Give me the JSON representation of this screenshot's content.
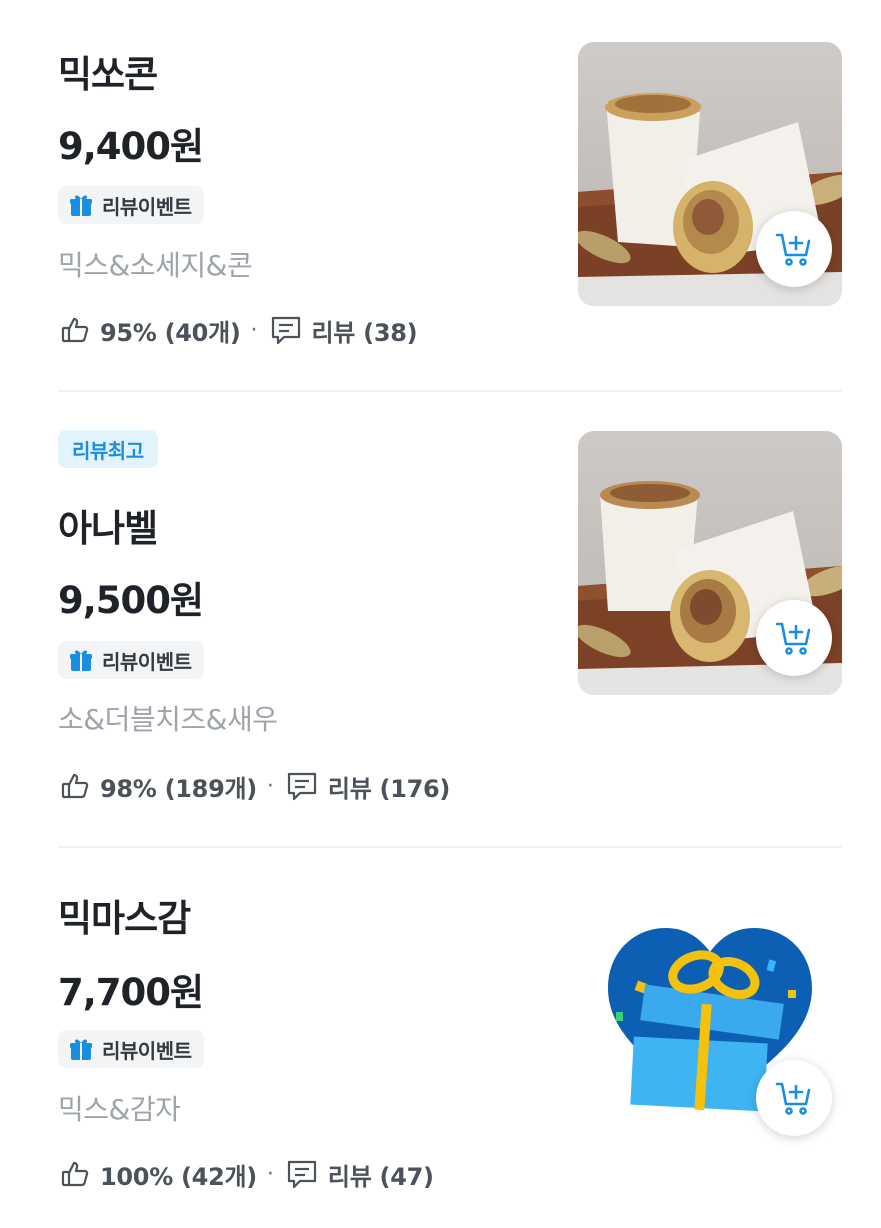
{
  "items": [
    {
      "name": "믹쏘콘",
      "price": "9,400원",
      "event_label": "리뷰이벤트",
      "description": "믹스&소세지&콘",
      "like_text": "95% (40개)",
      "separator": "·",
      "review_text": "리뷰 (38)"
    },
    {
      "badge": "리뷰최고",
      "name": "아나벨",
      "price": "9,500원",
      "event_label": "리뷰이벤트",
      "description": "소&더블치즈&새우",
      "like_text": "98% (189개)",
      "separator": "·",
      "review_text": "리뷰 (176)"
    },
    {
      "name": "믹마스감",
      "price": "7,700원",
      "event_label": "리뷰이벤트",
      "description": "믹스&감자",
      "like_text": "100% (42개)",
      "separator": "·",
      "review_text": "리뷰 (47)"
    }
  ],
  "icons": {
    "gift": "gift-icon",
    "like": "thumbs-up-icon",
    "review": "chat-bubble-icon",
    "cart": "cart-add-icon"
  },
  "colors": {
    "accent_blue": "#1a8fe0",
    "text_dark": "#1f2329",
    "text_muted": "#9ea4ab",
    "badge_bg": "#f2f4f6",
    "best_badge_bg": "#e3f3fd"
  }
}
